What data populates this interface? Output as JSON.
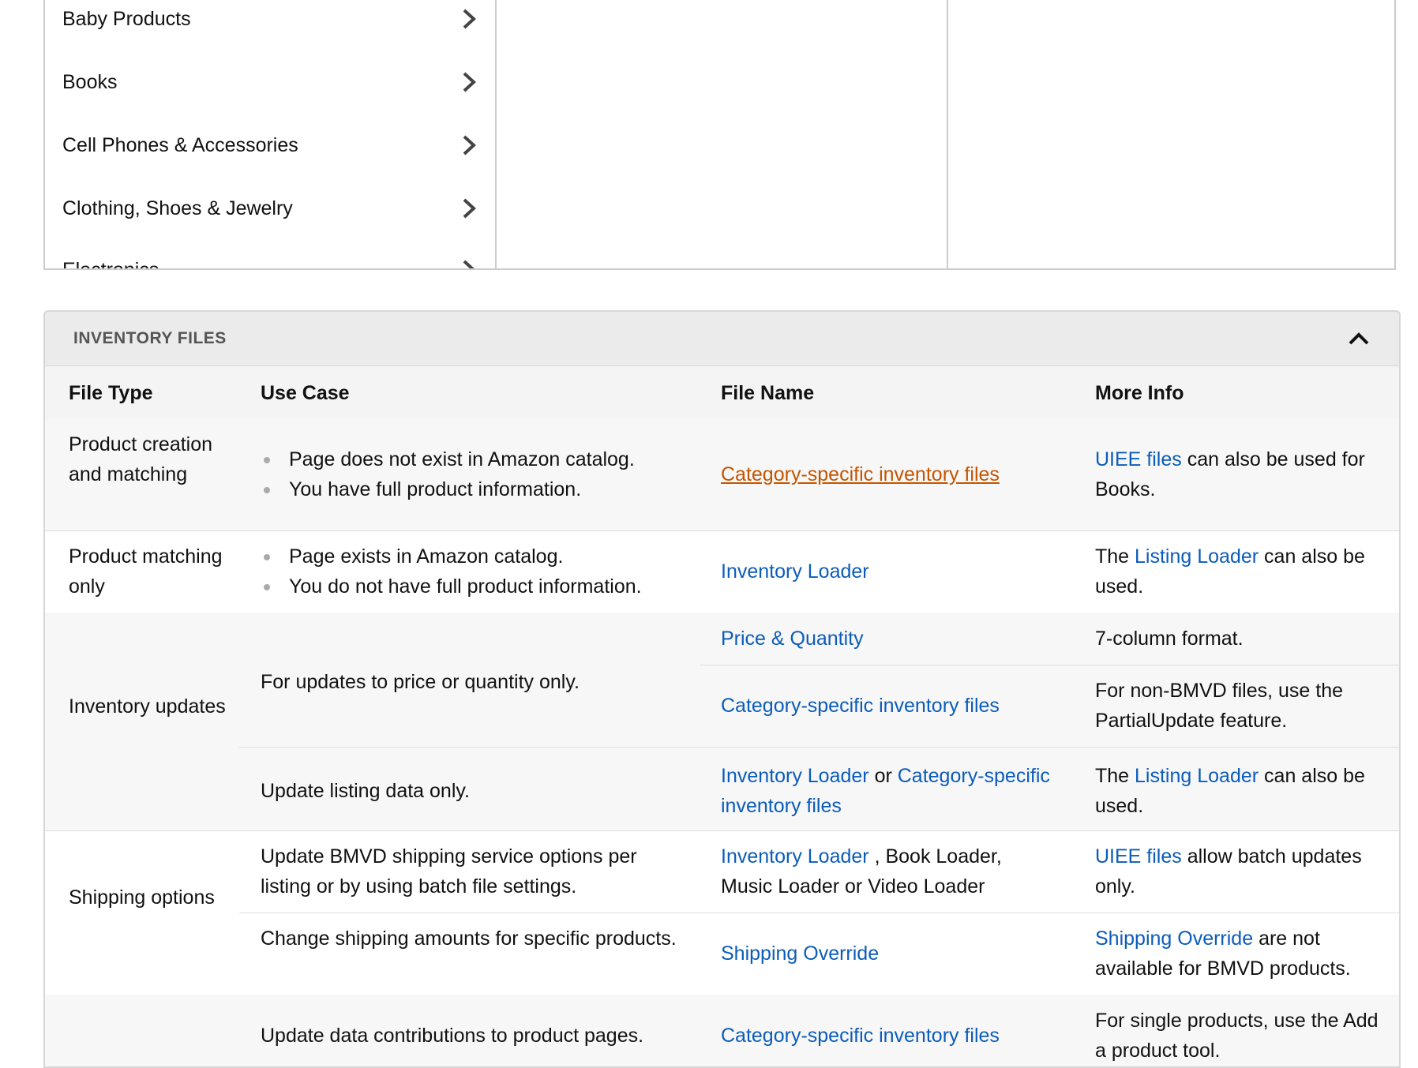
{
  "categories": {
    "items": [
      {
        "label": "Baby Products"
      },
      {
        "label": "Books"
      },
      {
        "label": "Cell Phones & Accessories"
      },
      {
        "label": "Clothing, Shoes & Jewelry"
      },
      {
        "label": "Electronics"
      }
    ]
  },
  "inventory": {
    "title": "INVENTORY FILES",
    "columns": [
      "File Type",
      "Use Case",
      "File Name",
      "More Info"
    ],
    "rows": {
      "r1": {
        "type": "Product creation and matching",
        "uses": [
          "Page does not exist in Amazon catalog.",
          "You have full product information."
        ],
        "file": "Category-specific inventory files",
        "info_link": "UIEE files",
        "info_text": " can also be used for Books."
      },
      "r2": {
        "type": "Product matching only",
        "uses": [
          "Page exists in Amazon catalog.",
          "You do not have full product information."
        ],
        "file": "Inventory Loader",
        "info_pre": "The ",
        "info_link": "Listing Loader",
        "info_text": " can also be used."
      },
      "r3": {
        "type": "Inventory updates",
        "use_a": "For updates to price or quantity only.",
        "file_a1": "Price & Quantity",
        "info_a1": "7-column format.",
        "file_a2": "Category-specific inventory files",
        "info_a2": "For non-BMVD files, use the PartialUpdate feature.",
        "use_b": "Update listing data only.",
        "file_b_link1": "Inventory Loader",
        "file_b_or": " or ",
        "file_b_link2": "Category-specific inventory files",
        "info_b_pre": "The ",
        "info_b_link": "Listing Loader",
        "info_b_text": " can also be used."
      },
      "r4": {
        "type": "Shipping options",
        "use_a": "Update BMVD shipping service options per listing or by using batch file settings.",
        "file_a_link": "Inventory Loader",
        "file_a_text": " , Book Loader, Music Loader or Video Loader",
        "info_a_link": "UIEE files",
        "info_a_text": " allow batch updates only.",
        "use_b": "Change shipping amounts for specific products.",
        "file_b": "Shipping Override",
        "info_b_link": "Shipping Override",
        "info_b_text": " are not available for BMVD products."
      },
      "r5": {
        "use": "Update data contributions to product pages.",
        "file": "Category-specific inventory files",
        "info": "For single products, use the Add a product tool."
      }
    }
  },
  "colors": {
    "link": "#0b5cba",
    "visited_link": "#c45500",
    "header_bg": "#ebebeb"
  }
}
